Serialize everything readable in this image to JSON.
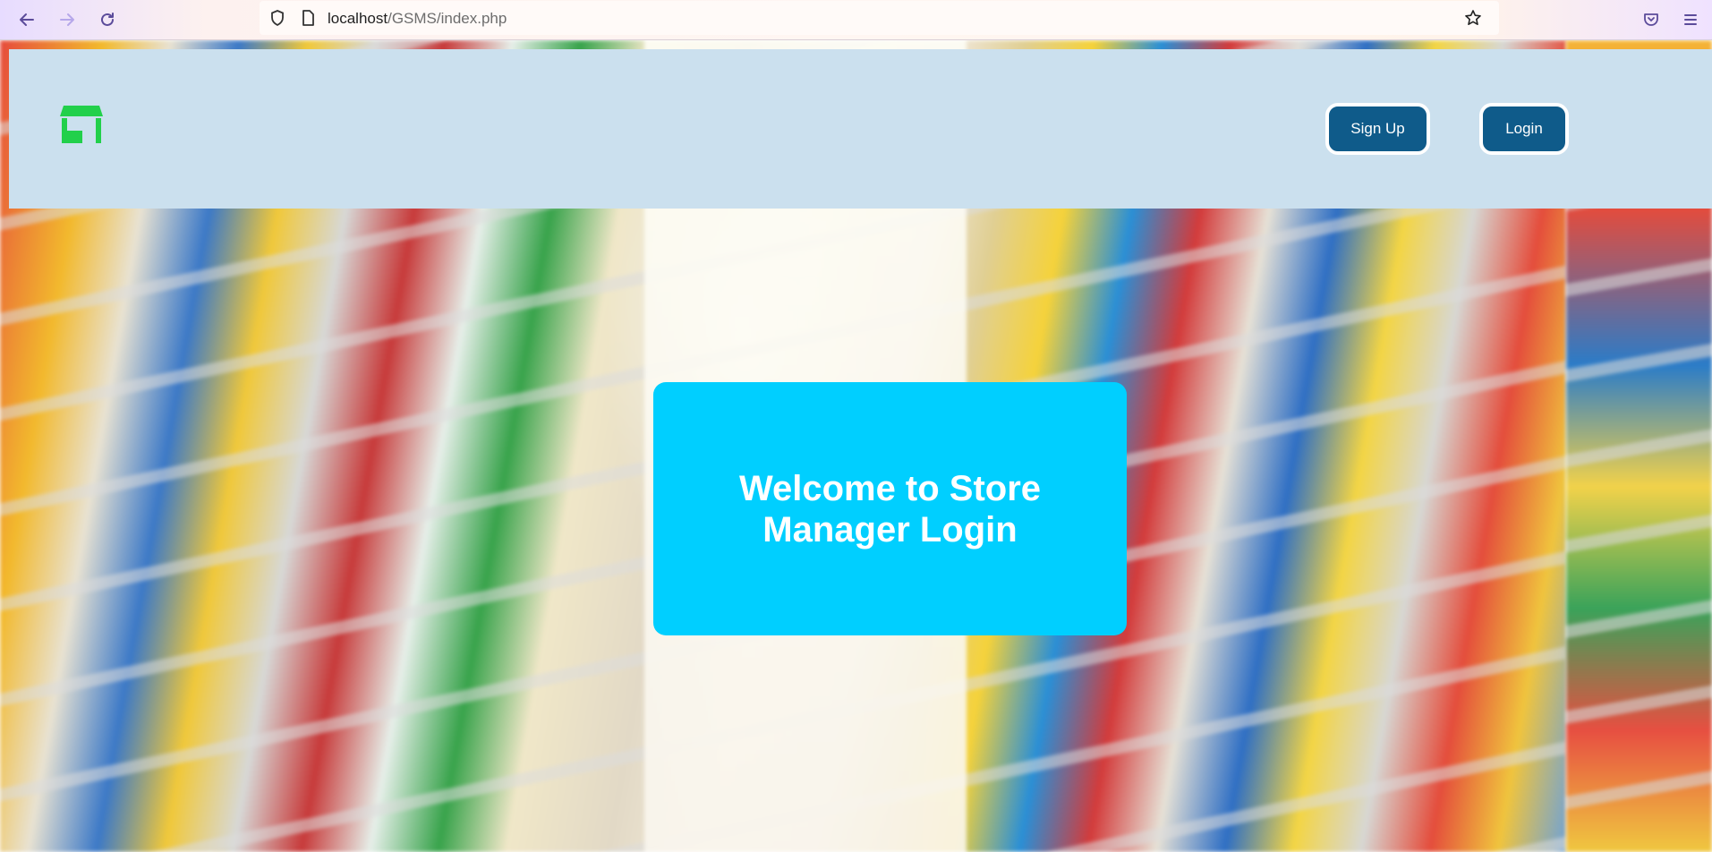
{
  "browser": {
    "url_host": "localhost",
    "url_path": "/GSMS/index.php"
  },
  "header": {
    "logo_icon": "store-icon",
    "signup_label": "Sign Up",
    "login_label": "Login",
    "logo_color": "#22d04b",
    "button_color": "#0f5b8a",
    "background_color": "#cbe0ee"
  },
  "main": {
    "welcome_title": "Welcome to Store Manager Login",
    "card_color": "#00cfff"
  }
}
